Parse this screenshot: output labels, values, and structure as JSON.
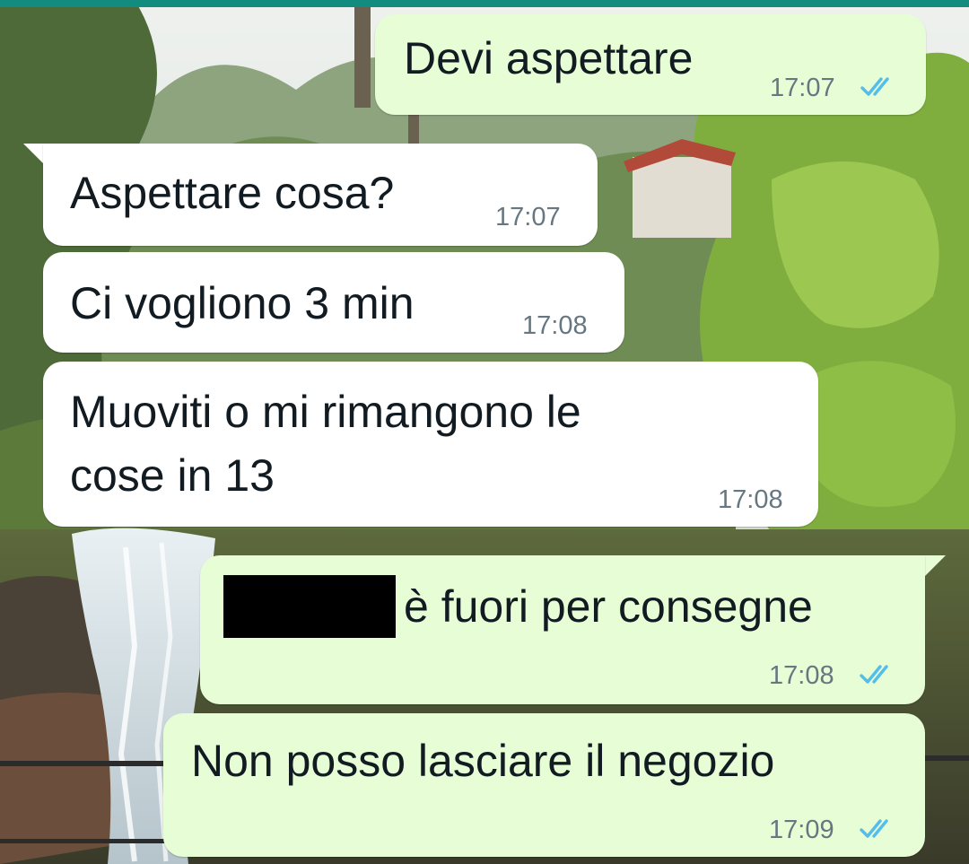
{
  "colors": {
    "incoming_bubble": "#ffffff",
    "outgoing_bubble": "#e7fdd6",
    "read_tick": "#53bdeb",
    "text": "#111b21",
    "meta": "#667781",
    "top_bar": "#128C7E"
  },
  "messages": [
    {
      "direction": "outgoing",
      "text": "Devi aspettare",
      "time": "17:07",
      "status": "read"
    },
    {
      "direction": "incoming",
      "text": "Aspettare cosa?",
      "time": "17:07"
    },
    {
      "direction": "incoming",
      "text": "Ci vogliono 3 min",
      "time": "17:08"
    },
    {
      "direction": "incoming",
      "text_line1": "Muoviti o mi rimangono le",
      "text_line2": "cose in 13",
      "time": "17:08"
    },
    {
      "direction": "outgoing",
      "text": "è fuori per consegne",
      "redacted": true,
      "time": "17:08",
      "status": "read"
    },
    {
      "direction": "outgoing",
      "text": "Non posso lasciare il negozio",
      "time": "17:09",
      "status": "read"
    }
  ],
  "icons": {
    "read_receipt": "double-check-icon",
    "wallpaper": "forest-waterfall-wallpaper"
  }
}
